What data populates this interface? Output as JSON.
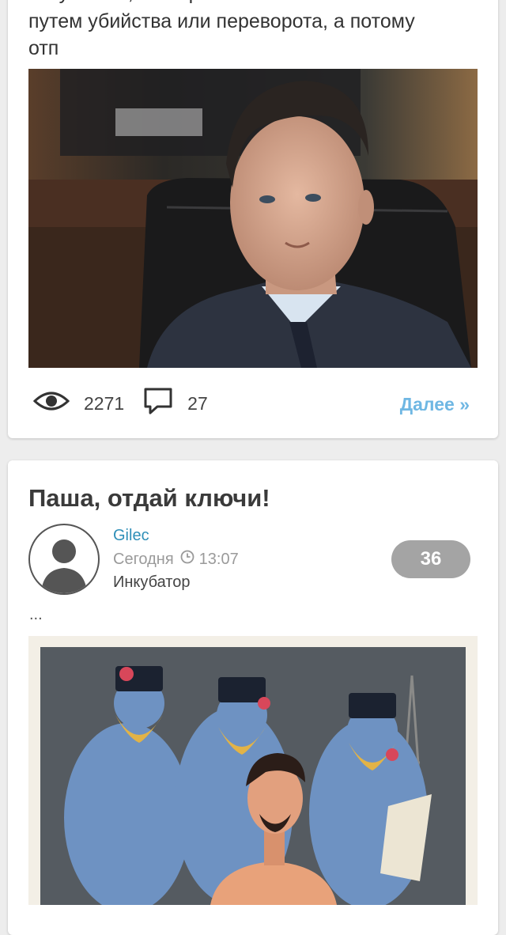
{
  "post1": {
    "excerpt_cut_line": "покушался, что Иран покончит с его властью",
    "excerpt_line2": "путем убийства или переворота, а потому",
    "excerpt_line3": "отп",
    "views": "2271",
    "comments": "27",
    "more_label": "Далее »"
  },
  "post2": {
    "title": "Паша, отдай ключи!",
    "author": "Gilec",
    "date": "Сегодня",
    "time": "13:07",
    "section": "Инкубатор",
    "comment_count": "36",
    "excerpt": "..."
  },
  "icons": {
    "views": "eye-icon",
    "comments": "comment-bubble-icon",
    "time": "clock-icon",
    "avatar": "user-silhouette-icon"
  },
  "colors": {
    "link": "#2f8fb8",
    "more": "#6fb7e3",
    "badge": "#a4a4a4",
    "background": "#ededed"
  }
}
